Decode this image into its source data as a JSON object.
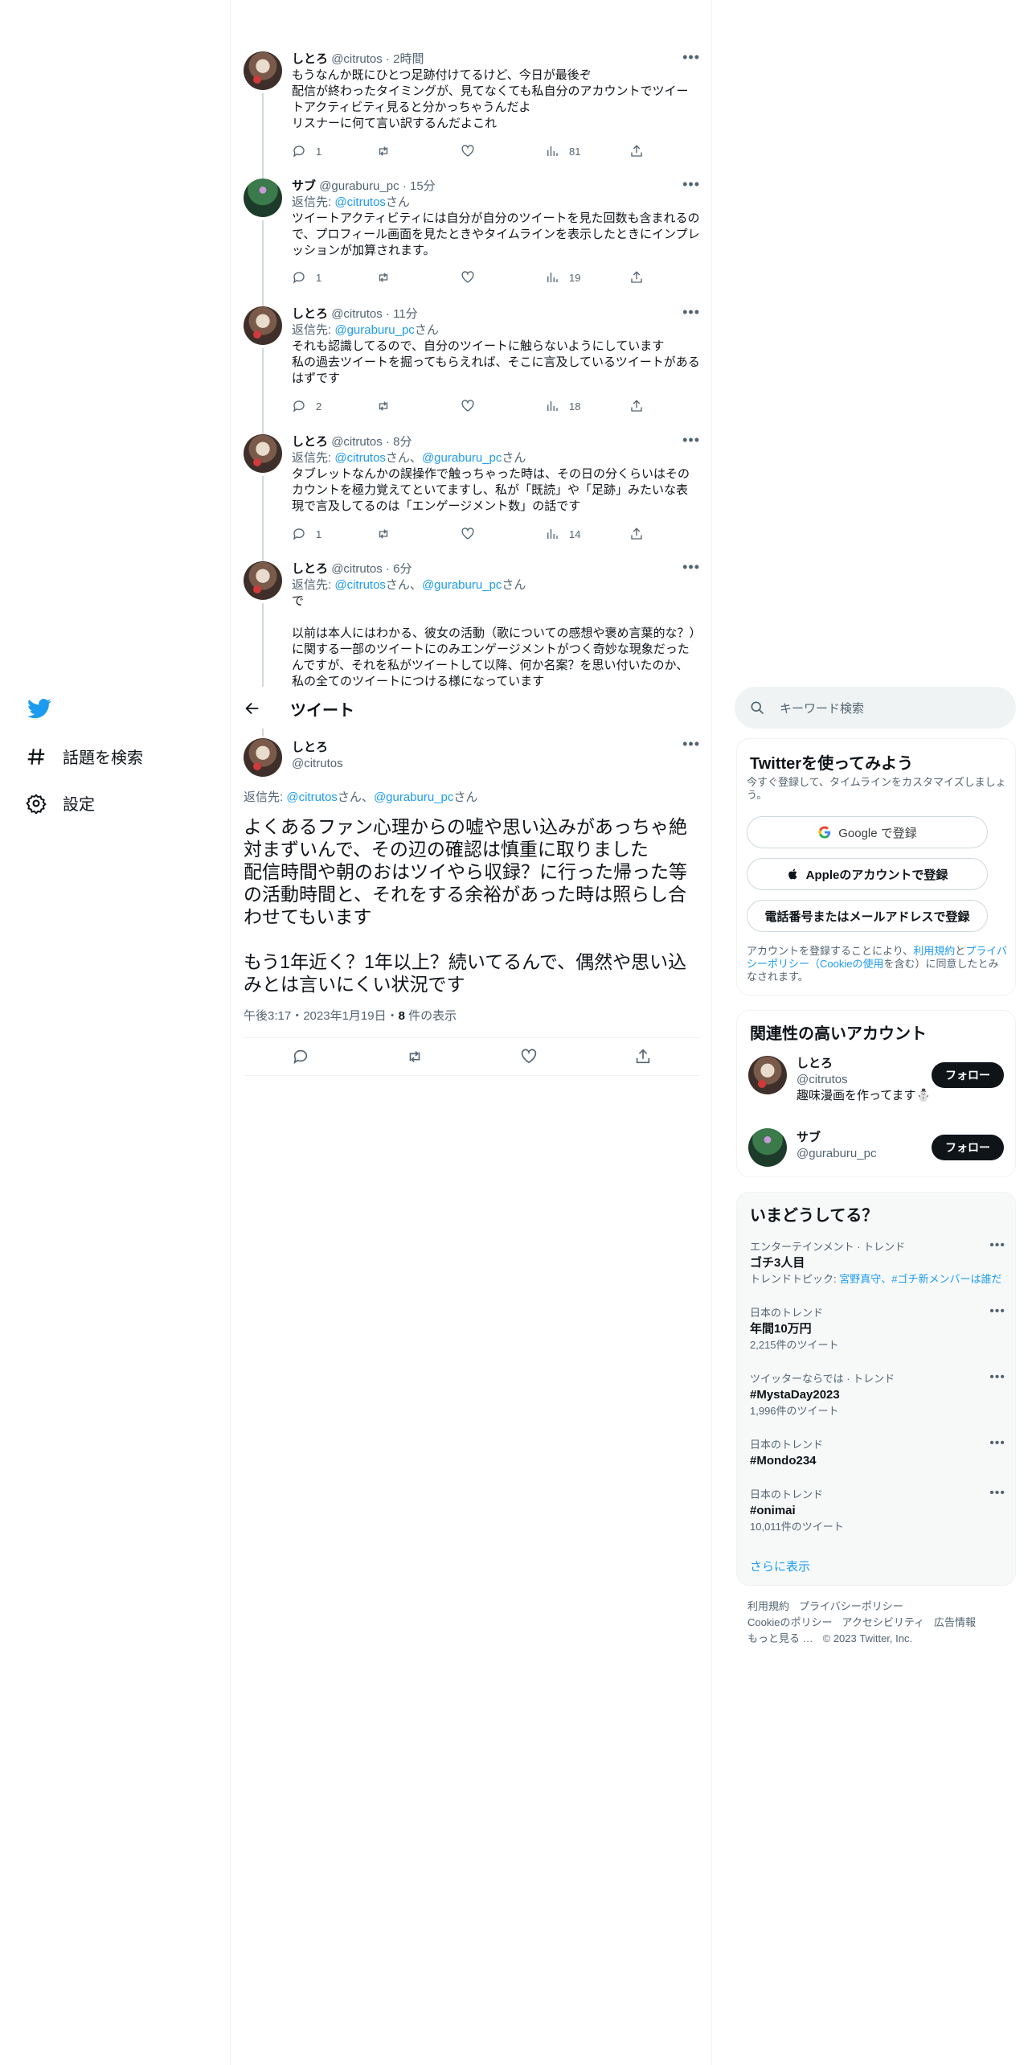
{
  "nav": {
    "explore": "話題を検索",
    "settings": "設定"
  },
  "header": {
    "title": "ツイート"
  },
  "thread": [
    {
      "name": "しとろ",
      "handle": "@citrutos",
      "time": "2時間",
      "text": "もうなんか既にひとつ足跡付けてるけど、今日が最後ぞ\n配信が終わったタイミングが、見てなくても私自分のアカウントでツイートアクティビティ見ると分かっちゃうんだよ\nリスナーに何て言い訳するんだよこれ",
      "replies": "1",
      "views": "81"
    },
    {
      "name": "サブ",
      "handle": "@guraburu_pc",
      "time": "15分",
      "reply_to": "返信先: ",
      "reply_link1": "@citrutos",
      "reply_suffix1": "さん",
      "text": "ツイートアクティビティには自分が自分のツイートを見た回数も含まれるので、プロフィール画面を見たときやタイムラインを表示したときにインプレッションが加算されます。",
      "replies": "1",
      "views": "19"
    },
    {
      "name": "しとろ",
      "handle": "@citrutos",
      "time": "11分",
      "reply_to": "返信先: ",
      "reply_link1": "@guraburu_pc",
      "reply_suffix1": "さん",
      "text": "それも認識してるので、自分のツイートに触らないようにしています\n私の過去ツイートを掘ってもらえれば、そこに言及しているツイートがあるはずです",
      "replies": "2",
      "views": "18"
    },
    {
      "name": "しとろ",
      "handle": "@citrutos",
      "time": "8分",
      "reply_to": "返信先: ",
      "reply_link1": "@citrutos",
      "reply_suffix1": "さん、",
      "reply_link2": "@guraburu_pc",
      "reply_suffix2": "さん",
      "text": "タブレットなんかの誤操作で触っちゃった時は、その日の分くらいはそのカウントを極力覚えてといてますし、私が「既読」や「足跡」みたいな表現で言及してるのは「エンゲージメント数」の話です",
      "replies": "1",
      "views": "14"
    },
    {
      "name": "しとろ",
      "handle": "@citrutos",
      "time": "6分",
      "reply_to": "返信先: ",
      "reply_link1": "@citrutos",
      "reply_suffix1": "さん、",
      "reply_link2": "@guraburu_pc",
      "reply_suffix2": "さん",
      "text": "で\n\n以前は本人にはわかる、彼女の活動（歌についての感想や褒め言葉的な？）に関する一部のツイートにのみエンゲージメントがつく奇妙な現象だったんですが、それを私がツイートして以降、何か名案？を思い付いたのか、私の全てのツイートにつける様になっています"
    }
  ],
  "main_tweet": {
    "name": "しとろ",
    "handle": "@citrutos",
    "reply_to": "返信先: ",
    "reply_link1": "@citrutos",
    "reply_suffix1": "さん、",
    "reply_link2": "@guraburu_pc",
    "reply_suffix2": "さん",
    "text": "よくあるファン心理からの嘘や思い込みがあっちゃ絶対まずいんで、その辺の確認は慎重に取りました\n配信時間や朝のおはツイやら収録？に行った帰った等の活動時間と、それをする余裕があった時は照らし合わせてもいます\n\nもう1年近く？1年以上？続いてるんで、偶然や思い込みとは言いにくい状況です",
    "timestamp": "午後3:17・2023年1月19日・",
    "views_count": "8",
    "views_label": " 件の表示"
  },
  "search": {
    "placeholder": "キーワード検索"
  },
  "signup": {
    "title": "Twitterを使ってみよう",
    "subtitle": "今すぐ登録して、タイムラインをカスタマイズしましょう。",
    "google": "Google で登録",
    "apple": "Appleのアカウントで登録",
    "phone": "電話番号またはメールアドレスで登録",
    "legal_1": "アカウントを登録することにより、",
    "legal_terms": "利用規約",
    "legal_2": "と",
    "legal_privacy": "プライバシーポリシー（Cookieの使用",
    "legal_3": "を含む）に同意したとみなされます。"
  },
  "related": {
    "title": "関連性の高いアカウント",
    "accounts": [
      {
        "name": "しとろ",
        "handle": "@citrutos",
        "bio": "趣味漫画を作ってます⛄",
        "follow": "フォロー"
      },
      {
        "name": "サブ",
        "handle": "@guraburu_pc",
        "follow": "フォロー"
      }
    ]
  },
  "trends": {
    "title": "いまどうしてる？",
    "items": [
      {
        "category": "エンターテインメント · トレンド",
        "name": "ゴチ3人目",
        "sub_prefix": "トレンドトピック: ",
        "sub_links": "宮野真守、#ゴチ新メンバーは誰だ"
      },
      {
        "category": "日本のトレンド",
        "name": "年間10万円",
        "sub": "2,215件のツイート"
      },
      {
        "category": "ツイッターならでは · トレンド",
        "name": "#MystaDay2023",
        "sub": "1,996件のツイート"
      },
      {
        "category": "日本のトレンド",
        "name": "#Mondo234"
      },
      {
        "category": "日本のトレンド",
        "name": "#onimai",
        "sub": "10,011件のツイート"
      }
    ],
    "show_more": "さらに表示"
  },
  "footer": {
    "terms": "利用規約",
    "privacy": "プライバシーポリシー",
    "cookie": "Cookieのポリシー",
    "accessibility": "アクセシビリティ",
    "ads": "広告情報",
    "more": "もっと見る …",
    "copyright": "© 2023 Twitter, Inc."
  },
  "colors": {
    "accent": "#1d9bf0",
    "text": "#0f1419",
    "muted": "#536471"
  }
}
